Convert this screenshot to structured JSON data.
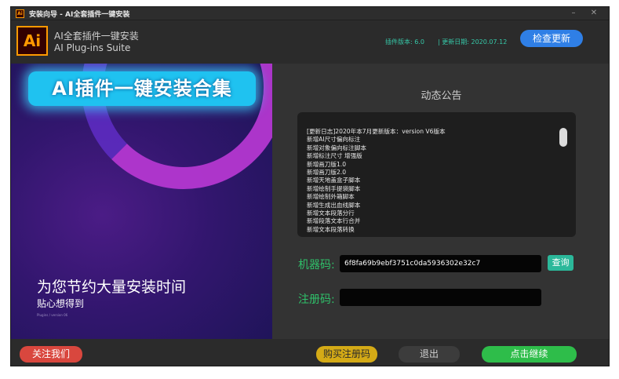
{
  "titlebar": {
    "icon_text": "Ai",
    "title": "安装向导 - AI全套插件一键安装",
    "min_glyph": "–",
    "close_glyph": "✕"
  },
  "header": {
    "logo_text": "Ai",
    "app_name_cn": "AI全套插件一键安装",
    "app_name_en": "AI Plug-ins Suite",
    "version_text": "插件版本: 6.0",
    "date_text": "| 更新日期: 2020.07.12",
    "check_update_label": "检查更新"
  },
  "banner": {
    "headline": "AI插件一键安装合集",
    "slogan": "为您节约大量安装时间",
    "sub_slogan": "贴心想得到",
    "tiny_text": "Plugins / version 06"
  },
  "notice": {
    "title": "动态公告",
    "lines": [
      "[更新日志]2020年本7月更新版本：version V6版本",
      "新增AI尺寸偏向标注",
      "新增对象偏向标注脚本",
      "新增标注尺寸 增强版",
      "新增画刀版1.0",
      "新增画刀版2.0",
      "新增天地盖盒子脚本",
      "新增绘制手提袋脚本",
      "新增绘制外箱脚本",
      "新增生成出血线脚本",
      "新增文本段落分行",
      "新增段落文本行合并",
      "新增文本段落转换"
    ]
  },
  "form": {
    "machine_code_label": "机器码:",
    "machine_code_value": "6f8fa69b9ebf3751c0da5936302e32c7",
    "query_label": "查询",
    "reg_code_label": "注册码:",
    "reg_code_value": ""
  },
  "footer": {
    "follow_label": "关注我们",
    "buy_label": "购买注册码",
    "exit_label": "退出",
    "continue_label": "点击继续"
  },
  "colors": {
    "accent_blue": "#2f7fe6",
    "green": "#2ebd4a",
    "red": "#d9473e",
    "gold": "#d4aa16",
    "teal": "#2bb89a",
    "ai_orange": "#ff9a00"
  }
}
